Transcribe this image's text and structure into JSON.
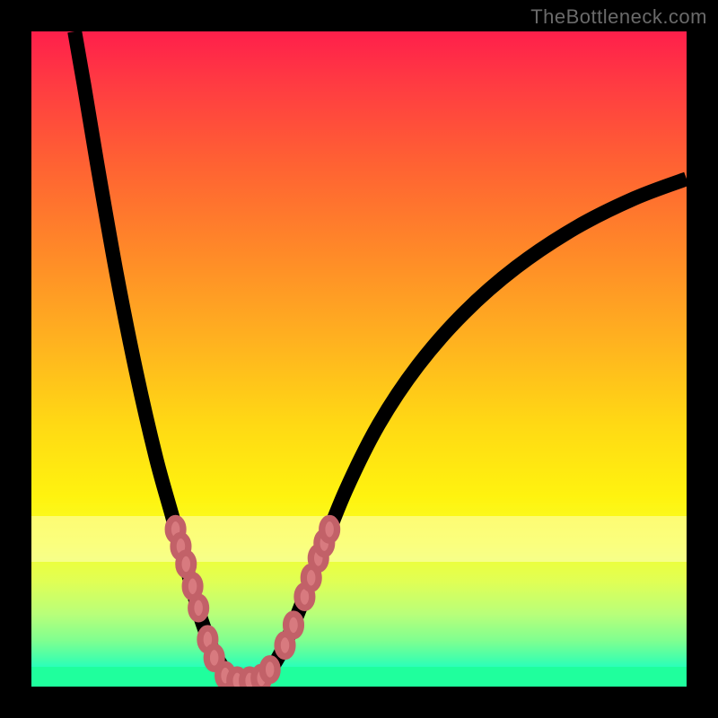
{
  "watermark": "TheBottleneck.com",
  "chart_data": {
    "type": "line",
    "title": "",
    "xlabel": "",
    "ylabel": "",
    "xlim": [
      0,
      100
    ],
    "ylim": [
      0,
      100
    ],
    "series": [
      {
        "name": "bottleneck-curve",
        "points": [
          {
            "x": 6.6,
            "y": 100.0
          },
          {
            "x": 8.0,
            "y": 92.0
          },
          {
            "x": 10.0,
            "y": 80.0
          },
          {
            "x": 13.0,
            "y": 63.0
          },
          {
            "x": 16.0,
            "y": 48.0
          },
          {
            "x": 19.0,
            "y": 35.0
          },
          {
            "x": 21.5,
            "y": 26.0
          },
          {
            "x": 24.0,
            "y": 17.0
          },
          {
            "x": 26.0,
            "y": 10.0
          },
          {
            "x": 28.0,
            "y": 5.0
          },
          {
            "x": 30.0,
            "y": 2.0
          },
          {
            "x": 32.0,
            "y": 0.8
          },
          {
            "x": 34.0,
            "y": 0.8
          },
          {
            "x": 36.0,
            "y": 2.0
          },
          {
            "x": 38.5,
            "y": 6.0
          },
          {
            "x": 41.0,
            "y": 12.0
          },
          {
            "x": 44.0,
            "y": 20.0
          },
          {
            "x": 48.0,
            "y": 30.0
          },
          {
            "x": 53.0,
            "y": 40.0
          },
          {
            "x": 59.0,
            "y": 49.0
          },
          {
            "x": 66.0,
            "y": 57.0
          },
          {
            "x": 74.0,
            "y": 64.0
          },
          {
            "x": 83.0,
            "y": 70.0
          },
          {
            "x": 92.0,
            "y": 74.5
          },
          {
            "x": 100.0,
            "y": 77.5
          }
        ]
      }
    ],
    "markers": [
      {
        "x": 22.0,
        "y": 24.0
      },
      {
        "x": 22.8,
        "y": 21.4
      },
      {
        "x": 23.6,
        "y": 18.7
      },
      {
        "x": 24.6,
        "y": 15.3
      },
      {
        "x": 25.5,
        "y": 12.0
      },
      {
        "x": 26.9,
        "y": 7.2
      },
      {
        "x": 27.9,
        "y": 4.4
      },
      {
        "x": 29.6,
        "y": 1.7
      },
      {
        "x": 31.4,
        "y": 0.9
      },
      {
        "x": 33.3,
        "y": 0.9
      },
      {
        "x": 35.1,
        "y": 1.3
      },
      {
        "x": 36.4,
        "y": 2.6
      },
      {
        "x": 38.7,
        "y": 6.3
      },
      {
        "x": 40.0,
        "y": 9.4
      },
      {
        "x": 41.7,
        "y": 13.7
      },
      {
        "x": 42.7,
        "y": 16.6
      },
      {
        "x": 43.8,
        "y": 19.6
      },
      {
        "x": 44.7,
        "y": 21.9
      },
      {
        "x": 45.5,
        "y": 24.0
      }
    ],
    "background_gradient": {
      "stops": [
        {
          "pos": 0.0,
          "color": "#ff1f4b"
        },
        {
          "pos": 0.5,
          "color": "#ffd328"
        },
        {
          "pos": 0.8,
          "color": "#f3ff35"
        },
        {
          "pos": 1.0,
          "color": "#1cffb0"
        }
      ]
    }
  }
}
